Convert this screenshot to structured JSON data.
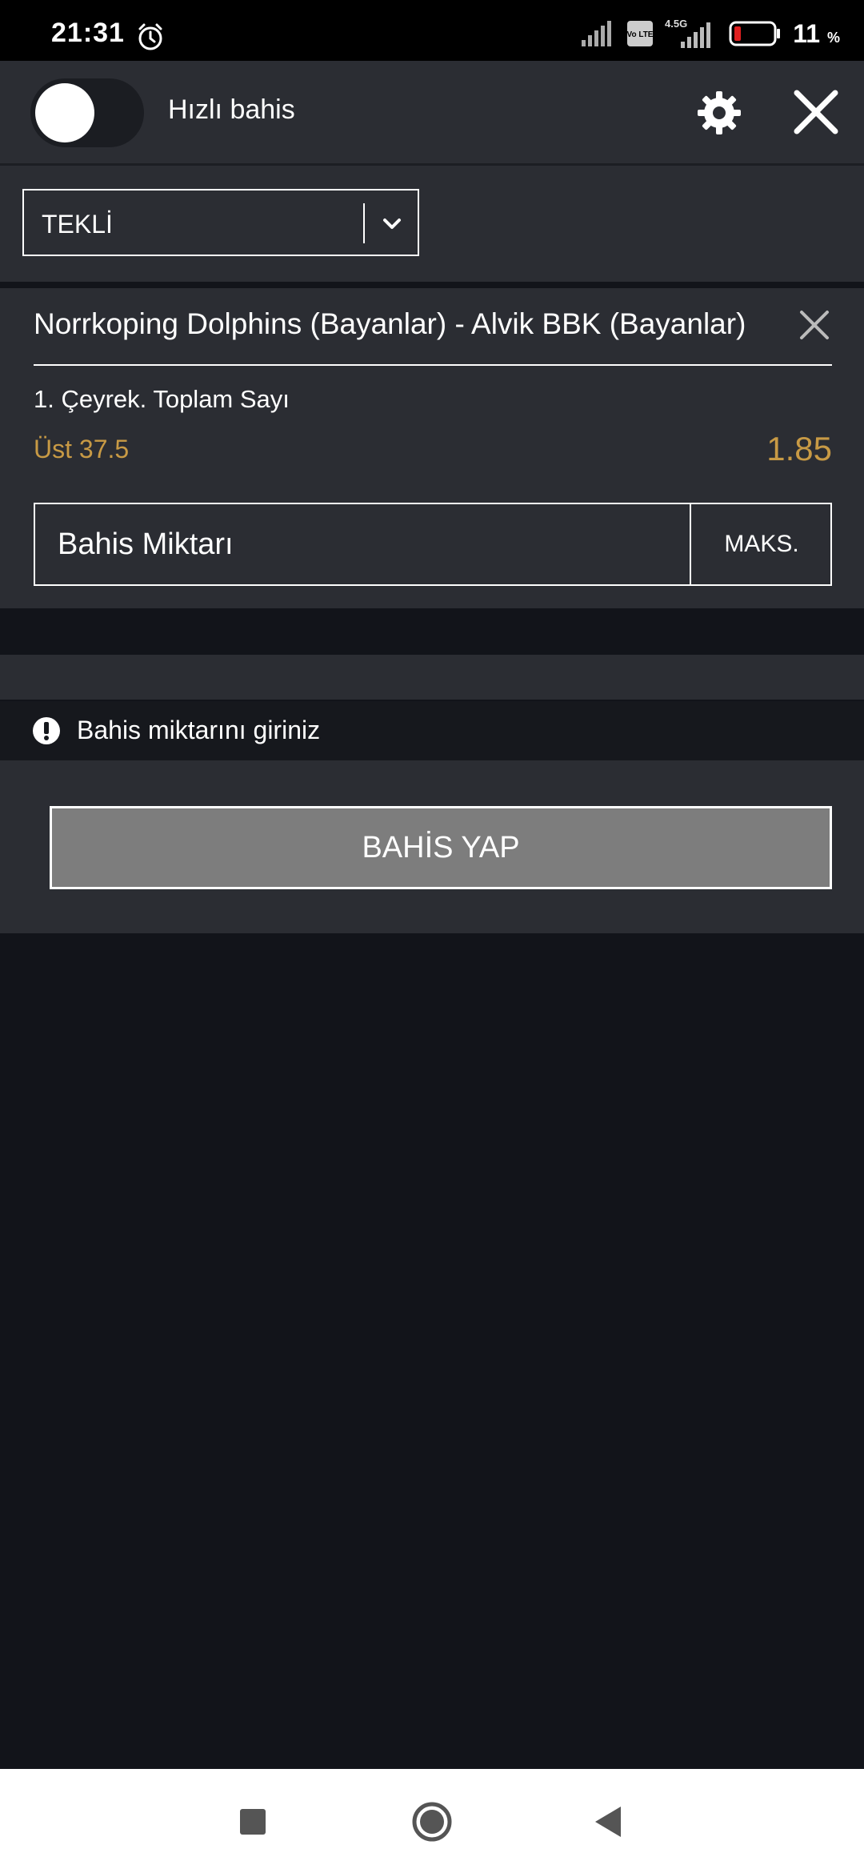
{
  "status_bar": {
    "time": "21:31",
    "battery_percent": "11",
    "battery_unit": "%",
    "icons": [
      "alarm-icon",
      "signal-icon",
      "volte-icon",
      "4.5g-signal-icon",
      "battery-icon"
    ],
    "network_label": "4.5G",
    "volte_label": "Vo LTE"
  },
  "header": {
    "quick_bet_label": "Hızlı bahis",
    "quick_bet_enabled": false
  },
  "bet_type": {
    "selected": "TEKLİ"
  },
  "bet": {
    "match": "Norrkoping Dolphins (Bayanlar) - Alvik BBK (Bayanlar)",
    "market": "1. Çeyrek. Toplam Sayı",
    "selection": "Üst 37.5",
    "odds": "1.85",
    "stake_placeholder": "Bahis Miktarı",
    "max_label": "MAKS."
  },
  "warning": {
    "text": "Bahis miktarını giriniz"
  },
  "actions": {
    "place_bet_label": "BAHİS YAP"
  },
  "colors": {
    "accent_gold": "#c89a45",
    "panel": "#2b2d33",
    "background": "#12141a",
    "button_disabled": "#7d7d7d"
  }
}
